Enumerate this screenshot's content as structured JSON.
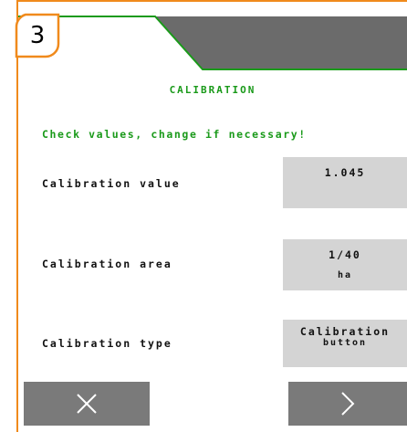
{
  "step": {
    "number": "3"
  },
  "page": {
    "title": "CALIBRATION",
    "hint": "Check values, change if necessary!"
  },
  "fields": [
    {
      "label": "Calibration value",
      "value": "1.045",
      "unit": ""
    },
    {
      "label": "Calibration area",
      "value": "1/40",
      "unit": "ha"
    },
    {
      "label": "Calibration type",
      "value": "Calibration",
      "unit": "button"
    }
  ],
  "buttons": {
    "cancel_icon": "close-icon",
    "next_icon": "chevron-right-icon"
  },
  "colors": {
    "accent": "#f08a1c",
    "title_green": "#1a9a1a",
    "header_gray": "#6b6b6b",
    "field_gray": "#d4d4d4",
    "button_gray": "#7a7a7a"
  }
}
